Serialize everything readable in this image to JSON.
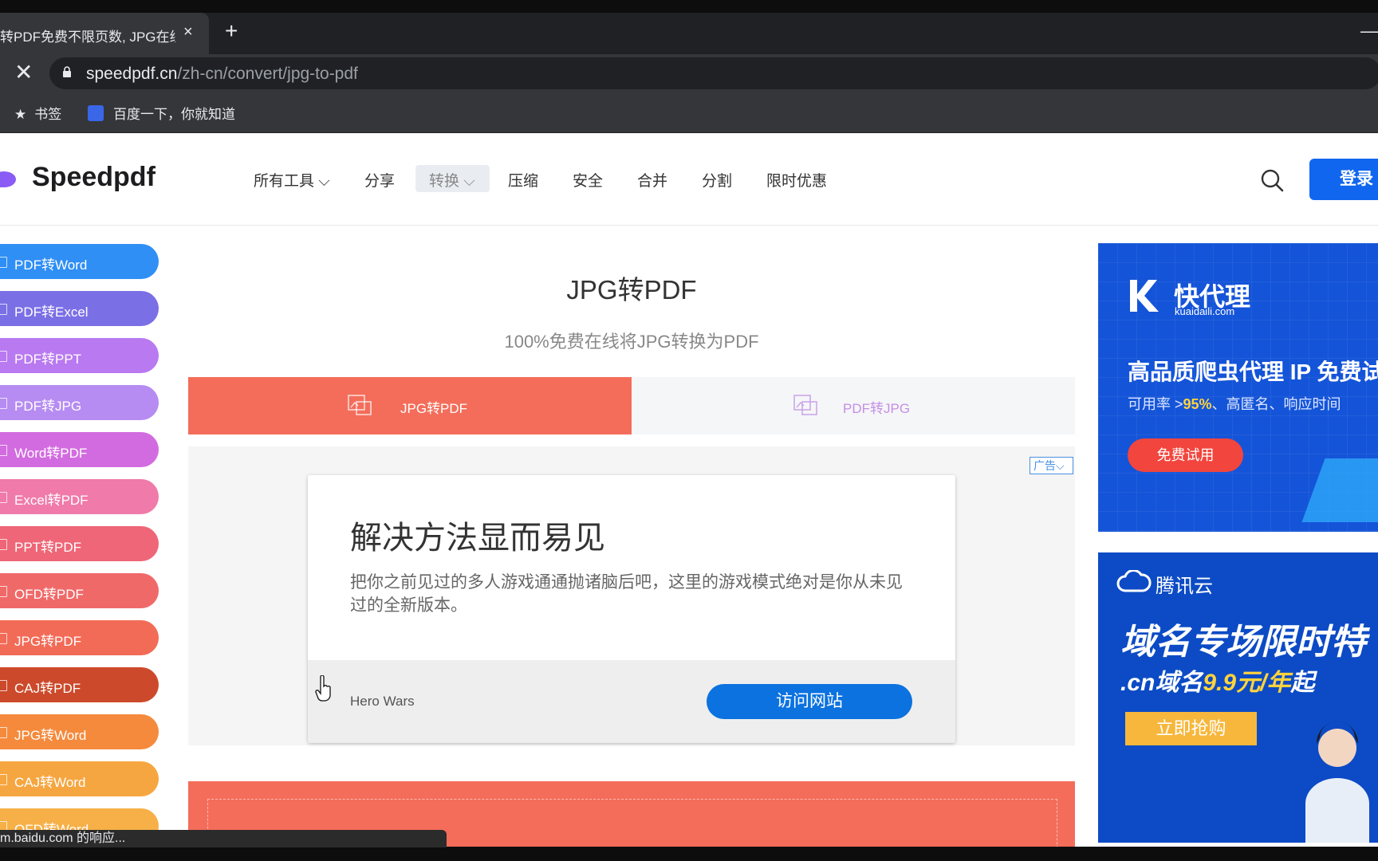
{
  "browser": {
    "tab_title": "转PDF免费不限页数, JPG在线",
    "tab_close": "×",
    "new_tab": "+",
    "minimize": "—",
    "stop": "✕",
    "url_host": "speedpdf.cn",
    "url_path": "/zh-cn/convert/jpg-to-pdf",
    "bookmarks": [
      {
        "label": "书签",
        "icon": "star-icon"
      },
      {
        "label": "百度一下，你就知道",
        "icon": "baidu-paw-icon"
      }
    ],
    "status_text": "m.baidu.com 的响应..."
  },
  "header": {
    "logo": "Speedpdf",
    "nav": [
      "所有工具",
      "分享",
      "转换",
      "压缩",
      "安全",
      "合并",
      "分割",
      "限时优惠"
    ],
    "active_nav": "转换",
    "login": "登录"
  },
  "sidebar": {
    "items": [
      {
        "label": "PDF转Word",
        "color": "#2f8ff5"
      },
      {
        "label": "PDF转Excel",
        "color": "#7b6fe6"
      },
      {
        "label": "PDF转PPT",
        "color": "#b979f0"
      },
      {
        "label": "PDF转JPG",
        "color": "#b68cf2"
      },
      {
        "label": "Word转PDF",
        "color": "#d36be0"
      },
      {
        "label": "Excel转PDF",
        "color": "#f07aa9"
      },
      {
        "label": "PPT转PDF",
        "color": "#ee6677"
      },
      {
        "label": "OFD转PDF",
        "color": "#f06969"
      },
      {
        "label": "JPG转PDF",
        "color": "#f26b57"
      },
      {
        "label": "CAJ转PDF",
        "color": "#cc4a2b"
      },
      {
        "label": "JPG转Word",
        "color": "#f58a3c"
      },
      {
        "label": "CAJ转Word",
        "color": "#f6a640"
      },
      {
        "label": "OFD转Word",
        "color": "#f6b047"
      }
    ]
  },
  "main": {
    "title": "JPG转PDF",
    "subtitle": "100%免费在线将JPG转换为PDF",
    "tabs": [
      {
        "label": "JPG转PDF",
        "active": true
      },
      {
        "label": "PDF转JPG",
        "active": false
      }
    ],
    "ad": {
      "badge": "广告",
      "headline": "解决方法显而易见",
      "body": "把你之前见过的多人游戏通通抛诸脑后吧，这里的游戏模式绝对是你从未见过的全新版本。",
      "brand": "Hero Wars",
      "cta": "访问网站"
    }
  },
  "right_ads": {
    "ad1": {
      "brand": "快代理",
      "domain": "kuaidaili.com",
      "headline": "高品质爬虫代理 IP 免费试",
      "sub_prefix": "可用率 >",
      "sub_value": "95%",
      "sub_suffix": "、高匿名、响应时间",
      "cta": "免费试用"
    },
    "ad2": {
      "brand": "腾讯云",
      "headline": "域名专场限时特",
      "sub_prefix": ".cn域名",
      "sub_value": "9.9元/年",
      "sub_suffix": "起",
      "cta": "立即抢购"
    }
  },
  "colors": {
    "accent_blue": "#1066ee",
    "converter_red": "#f46d5a"
  }
}
